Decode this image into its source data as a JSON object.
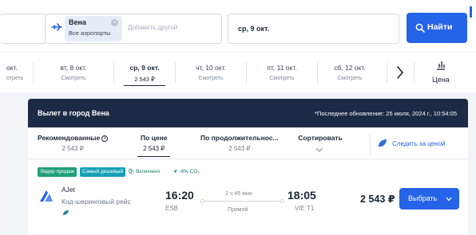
{
  "search": {
    "destination_title": "Вена",
    "destination_sub": "Все аэропорты",
    "add_other_placeholder": "Добавить другой",
    "date": "ср, 9 окт.",
    "find_label": "Найти"
  },
  "date_strip": {
    "items": [
      {
        "label": "окт.",
        "price": "отреть"
      },
      {
        "label": "вт, 8 окт.",
        "price": "Смотреть"
      },
      {
        "label": "ср, 9 окт.",
        "price": "2 543 ₽",
        "active": true
      },
      {
        "label": "чт, 10 окт.",
        "price": "Смотреть"
      },
      {
        "label": "пт, 11 окт.",
        "price": "Смотреть"
      },
      {
        "label": "сб, 12 окт.",
        "price": "Смотреть"
      }
    ],
    "price_label": "Цена"
  },
  "results": {
    "title": "Вылет в город Вена",
    "update_note": "*Последнее обновление: 25 июля, 2024 г., 10:54:05",
    "sort": [
      {
        "title": "Рекомендованные",
        "price": "2 543 ₽"
      },
      {
        "title": "По цене",
        "price": "2 543 ₽",
        "active": true
      },
      {
        "title": "По продолжительнос...",
        "price": "2 543 ₽"
      },
      {
        "title": "Сортировать"
      }
    ],
    "track_price": "Следить за ценой",
    "tags": [
      "Лидер продаж",
      "Самый дешевый",
      "Включено",
      "-8% CO₂"
    ],
    "flight": {
      "airline": "AJet",
      "codeshare": "Код-шеринговый рейс",
      "dep_time": "16:20",
      "dep_code": "ESB",
      "duration": "2 ч 45 мин",
      "stops": "Прямой",
      "arr_time": "18:05",
      "arr_code": "VIE T1",
      "price": "2 543 ₽",
      "select_label": "Выбрать"
    }
  },
  "colors": {
    "accent": "#2563e8",
    "header_dark": "#1c2b45",
    "eco_green": "#1fa07b"
  }
}
